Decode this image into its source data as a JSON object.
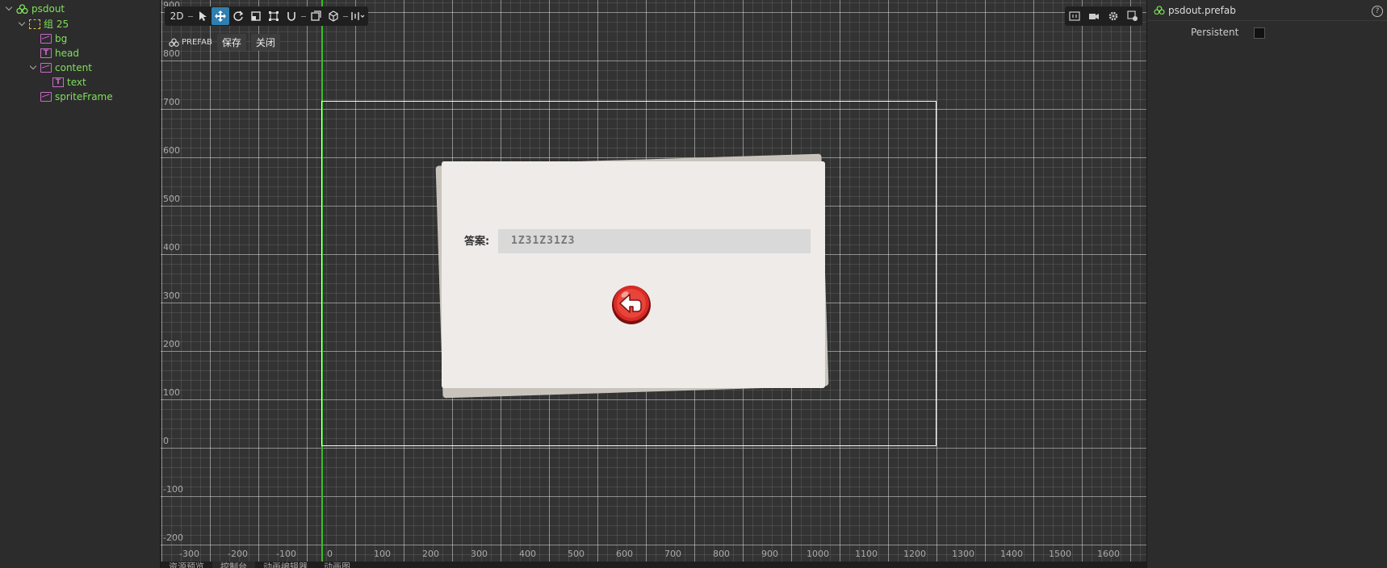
{
  "hierarchy": {
    "nodes": [
      {
        "label": "psdout",
        "icon": "prefab-icon"
      },
      {
        "label": "组 25",
        "icon": "group-icon"
      },
      {
        "label": "bg",
        "icon": "sprite-icon"
      },
      {
        "label": "head",
        "icon": "label-icon"
      },
      {
        "label": "content",
        "icon": "sprite-icon"
      },
      {
        "label": "text",
        "icon": "label-icon"
      },
      {
        "label": "spriteFrame",
        "icon": "sprite-icon"
      }
    ]
  },
  "toolbar": {
    "mode_2d": "2D",
    "tools": [
      "select-tool-icon",
      "move-tool-icon",
      "rotate-tool-icon",
      "scale-tool-icon",
      "rect-tool-icon",
      "snap-icon",
      "transform-space-icon",
      "pivot-icon",
      "align-icon"
    ]
  },
  "prefab_bar": {
    "tag": "PREFAB",
    "save": "保存",
    "close": "关闭"
  },
  "view_tools": [
    "resolution-icon",
    "camera-icon",
    "settings-icon",
    "scene-gizmo-icon"
  ],
  "axes": {
    "y_ticks": [
      "900",
      "800",
      "700",
      "600",
      "500",
      "400",
      "300",
      "200",
      "100",
      "0",
      "-100",
      "-200"
    ],
    "x_ticks": [
      "-300",
      "-200",
      "-100",
      "0",
      "100",
      "200",
      "300",
      "400",
      "500",
      "600",
      "700",
      "800",
      "900",
      "1000",
      "1100",
      "1200",
      "1300",
      "1400",
      "1500",
      "1600"
    ]
  },
  "dialog": {
    "answer_label": "答案:",
    "answer_value": "1Z31Z31Z3"
  },
  "bottom_tabs": [
    "资源预览",
    "控制台",
    "动画编辑器",
    "动画图"
  ],
  "inspector": {
    "title": "psdout.prefab",
    "persistent_label": "Persistent",
    "persistent_checked": false
  }
}
